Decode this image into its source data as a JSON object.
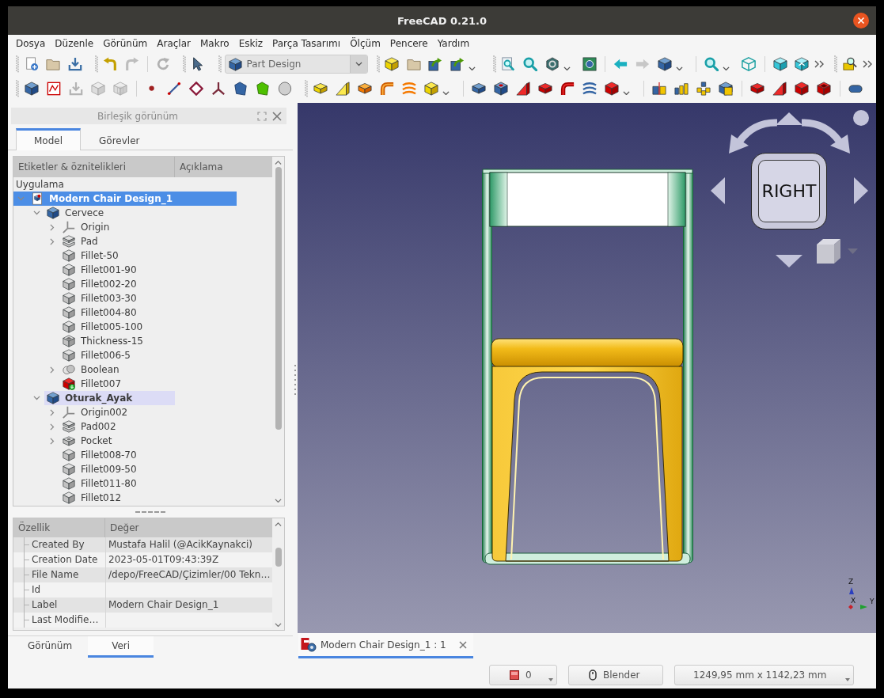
{
  "window": {
    "title": "FreeCAD 0.21.0"
  },
  "menu": [
    "Dosya",
    "Düzenle",
    "Görünüm",
    "Araçlar",
    "Makro",
    "Eskiz",
    "Parça Tasarımı",
    "Ölçüm",
    "Pencere",
    "Yardım"
  ],
  "toolbars": [
    {
      "groups": [
        {
          "items": [
            {
              "kind": "button",
              "disabled": false,
              "dropdown": false
            },
            {
              "kind": "button",
              "disabled": false,
              "dropdown": false
            },
            {
              "kind": "button",
              "disabled": false,
              "dropdown": false
            }
          ]
        },
        {
          "items": [
            {
              "kind": "button",
              "disabled": false,
              "dropdown": false
            },
            {
              "kind": "button",
              "disabled": true,
              "dropdown": false
            },
            {
              "kind": "separator"
            },
            {
              "kind": "button",
              "disabled": true,
              "dropdown": false
            }
          ]
        },
        {
          "items": [
            {
              "kind": "button",
              "disabled": false,
              "dropdown": false
            }
          ]
        },
        {
          "items": [
            {
              "kind": "selector",
              "value": "Part Design"
            }
          ]
        },
        {
          "items": [
            {
              "kind": "button",
              "disabled": false,
              "dropdown": false
            },
            {
              "kind": "button",
              "disabled": false,
              "dropdown": false
            },
            {
              "kind": "button",
              "disabled": false,
              "dropdown": false
            },
            {
              "kind": "button",
              "disabled": false,
              "dropdown": true
            }
          ]
        },
        {
          "items": [
            {
              "kind": "button",
              "disabled": false,
              "dropdown": false
            },
            {
              "kind": "button",
              "disabled": false,
              "dropdown": false
            },
            {
              "kind": "button",
              "disabled": false,
              "dropdown": true
            },
            {
              "kind": "button",
              "disabled": false,
              "dropdown": false
            },
            {
              "kind": "separator"
            },
            {
              "kind": "button",
              "disabled": false,
              "dropdown": false
            },
            {
              "kind": "button",
              "disabled": true,
              "dropdown": false
            },
            {
              "kind": "button",
              "disabled": false,
              "dropdown": true
            },
            {
              "kind": "separator"
            },
            {
              "kind": "button",
              "disabled": false,
              "dropdown": true
            },
            {
              "kind": "button",
              "disabled": false,
              "dropdown": false
            },
            {
              "kind": "separator"
            },
            {
              "kind": "button",
              "disabled": false,
              "dropdown": false
            },
            {
              "kind": "button",
              "disabled": false,
              "dropdown": false
            },
            {
              "kind": "overflow"
            }
          ]
        },
        {
          "items": [
            {
              "kind": "button",
              "disabled": false,
              "dropdown": false
            },
            {
              "kind": "overflow"
            }
          ]
        }
      ]
    },
    {
      "groups": [
        {
          "items": [
            {
              "kind": "button",
              "disabled": false,
              "dropdown": false
            },
            {
              "kind": "button",
              "disabled": false,
              "dropdown": false
            },
            {
              "kind": "button",
              "disabled": true,
              "dropdown": false
            },
            {
              "kind": "button",
              "disabled": true,
              "dropdown": false
            },
            {
              "kind": "button",
              "disabled": true,
              "dropdown": false
            },
            {
              "kind": "separator"
            },
            {
              "kind": "button",
              "disabled": false,
              "dropdown": false
            },
            {
              "kind": "button",
              "disabled": false,
              "dropdown": false
            },
            {
              "kind": "button",
              "disabled": false,
              "dropdown": false
            },
            {
              "kind": "button",
              "disabled": false,
              "dropdown": false
            },
            {
              "kind": "button",
              "disabled": false,
              "dropdown": false
            },
            {
              "kind": "button",
              "disabled": false,
              "dropdown": false
            },
            {
              "kind": "button",
              "disabled": false,
              "dropdown": false
            }
          ]
        },
        {
          "items": [
            {
              "kind": "button",
              "disabled": false,
              "dropdown": false
            },
            {
              "kind": "button",
              "disabled": false,
              "dropdown": false
            },
            {
              "kind": "button",
              "disabled": false,
              "dropdown": false
            },
            {
              "kind": "button",
              "disabled": false,
              "dropdown": false
            },
            {
              "kind": "button",
              "disabled": false,
              "dropdown": false
            },
            {
              "kind": "button",
              "disabled": false,
              "dropdown": true
            },
            {
              "kind": "separator"
            },
            {
              "kind": "button",
              "disabled": false,
              "dropdown": false
            },
            {
              "kind": "button",
              "disabled": false,
              "dropdown": false
            },
            {
              "kind": "button",
              "disabled": false,
              "dropdown": false
            },
            {
              "kind": "button",
              "disabled": false,
              "dropdown": false
            },
            {
              "kind": "button",
              "disabled": false,
              "dropdown": false
            },
            {
              "kind": "button",
              "disabled": false,
              "dropdown": false
            },
            {
              "kind": "button",
              "disabled": false,
              "dropdown": true
            },
            {
              "kind": "separator"
            },
            {
              "kind": "button",
              "disabled": false,
              "dropdown": false
            },
            {
              "kind": "button",
              "disabled": false,
              "dropdown": false
            },
            {
              "kind": "button",
              "disabled": false,
              "dropdown": false
            },
            {
              "kind": "button",
              "disabled": false,
              "dropdown": false
            },
            {
              "kind": "separator"
            },
            {
              "kind": "button",
              "disabled": false,
              "dropdown": false
            },
            {
              "kind": "button",
              "disabled": false,
              "dropdown": false
            },
            {
              "kind": "button",
              "disabled": false,
              "dropdown": false
            },
            {
              "kind": "button",
              "disabled": false,
              "dropdown": false
            },
            {
              "kind": "separator"
            },
            {
              "kind": "button",
              "disabled": false,
              "dropdown": false
            }
          ]
        }
      ]
    }
  ],
  "combo_view": {
    "title": "Birleşik görünüm",
    "tabs": [
      {
        "label": "Model",
        "selected": true
      },
      {
        "label": "Görevler",
        "selected": false
      }
    ],
    "tree": {
      "columns": [
        "Etiketler & öznitelikleri",
        "Açıklama"
      ],
      "root": "Uygulama",
      "items": [
        {
          "label": "Modern Chair Design_1",
          "kind": "document",
          "expanded": true,
          "selected": true,
          "children": [
            {
              "label": "Cervece",
              "kind": "body",
              "expanded": true,
              "selected": false,
              "active": false,
              "children": [
                {
                  "label": "Origin",
                  "kind": "origin",
                  "expanded": false,
                  "selected": false
                },
                {
                  "label": "Pad",
                  "kind": "pad",
                  "expanded": false,
                  "selected": false,
                  "visible": false
                },
                {
                  "label": "Fillet-50",
                  "kind": "fillet",
                  "selected": false,
                  "visible": false
                },
                {
                  "label": "Fillet001-90",
                  "kind": "fillet",
                  "selected": false,
                  "visible": false
                },
                {
                  "label": "Fillet002-20",
                  "kind": "fillet",
                  "selected": false,
                  "visible": false
                },
                {
                  "label": "Fillet003-30",
                  "kind": "fillet",
                  "selected": false,
                  "visible": false
                },
                {
                  "label": "Fillet004-80",
                  "kind": "fillet",
                  "selected": false,
                  "visible": false
                },
                {
                  "label": "Fillet005-100",
                  "kind": "fillet",
                  "selected": false,
                  "visible": false
                },
                {
                  "label": "Thickness-15",
                  "kind": "thickness",
                  "selected": false,
                  "visible": false
                },
                {
                  "label": "Fillet006-5",
                  "kind": "fillet",
                  "selected": false,
                  "visible": false
                },
                {
                  "label": "Boolean",
                  "kind": "boolean",
                  "expanded": false,
                  "selected": false,
                  "visible": false
                },
                {
                  "label": "Fillet007",
                  "kind": "fillet",
                  "selected": false,
                  "visible": true,
                  "tip": true
                }
              ]
            },
            {
              "label": "Oturak_Ayak",
              "kind": "body",
              "expanded": true,
              "selected": false,
              "active": true,
              "children": [
                {
                  "label": "Origin002",
                  "kind": "origin",
                  "expanded": false,
                  "selected": false
                },
                {
                  "label": "Pad002",
                  "kind": "pad",
                  "expanded": false,
                  "selected": false,
                  "visible": false
                },
                {
                  "label": "Pocket",
                  "kind": "pocket",
                  "expanded": false,
                  "selected": false,
                  "visible": false
                },
                {
                  "label": "Fillet008-70",
                  "kind": "fillet",
                  "selected": false,
                  "visible": false
                },
                {
                  "label": "Fillet009-50",
                  "kind": "fillet",
                  "selected": false,
                  "visible": false
                },
                {
                  "label": "Fillet011-80",
                  "kind": "fillet",
                  "selected": false,
                  "visible": false
                },
                {
                  "label": "Fillet012",
                  "kind": "fillet",
                  "selected": false,
                  "visible": false
                }
              ]
            }
          ]
        }
      ]
    },
    "properties": {
      "columns": [
        "Özellik",
        "Değer"
      ],
      "rows": [
        {
          "name": "Created By",
          "value": "Mustafa Halil (@AcikKaynakci)"
        },
        {
          "name": "Creation Date",
          "value": "2023-05-01T09:43:39Z"
        },
        {
          "name": "File Name",
          "value": "/depo/FreeCAD/Çizimler/00 Tekn…"
        },
        {
          "name": "Id"
        },
        {
          "name": "Label",
          "value": "Modern Chair Design_1"
        },
        {
          "name": "Last Modifie…"
        }
      ]
    },
    "property_tabs": [
      {
        "label": "Görünüm",
        "selected": false
      },
      {
        "label": "Veri",
        "selected": true
      }
    ]
  },
  "view_3d": {
    "nav_cube": {
      "face": "RIGHT"
    },
    "axes": [
      {
        "label": "Z",
        "color": "#2b3fbf"
      },
      {
        "label": "X",
        "color": "#c8202a"
      },
      {
        "label": "Y",
        "color": "#20a030"
      }
    ]
  },
  "document_tabs": [
    {
      "label": "Modern Chair Design_1 : 1",
      "selected": true
    }
  ],
  "status_bar": [
    {
      "kind": "counter",
      "text": "0"
    },
    {
      "kind": "navigation",
      "text": "Blender"
    },
    {
      "kind": "dimensions",
      "text": "1249,95 mm x 1142,23 mm"
    }
  ]
}
